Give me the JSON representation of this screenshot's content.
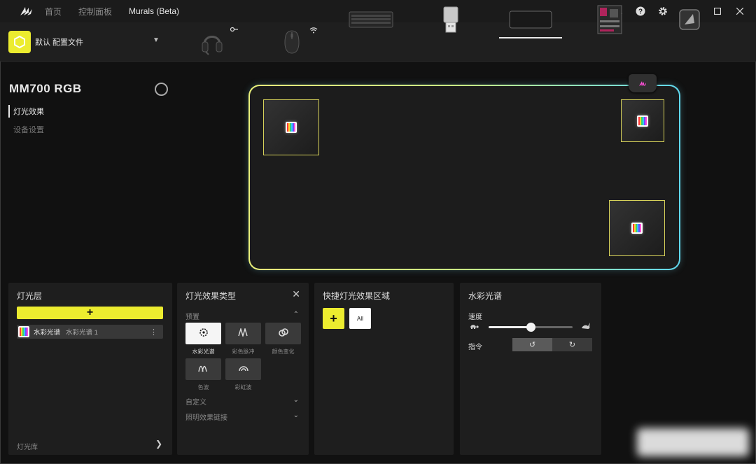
{
  "titlebar": {
    "nav": [
      "首页",
      "控制面板",
      "Murals (Beta)"
    ],
    "icons": [
      "bell-icon",
      "help-icon",
      "gear-icon",
      "minimize-icon",
      "maximize-icon",
      "close-icon"
    ]
  },
  "profile": {
    "label": "默认 配置文件"
  },
  "devices": [
    "headset-device",
    "mouse-device",
    "keyboard-device",
    "wireless-dongle-device",
    "mousepad-device",
    "motherboard-device",
    "corsair-hub-device"
  ],
  "device": {
    "title": "MM700 RGB",
    "tabs": [
      "灯光效果",
      "设备设置"
    ]
  },
  "layers_panel": {
    "title": "灯光层",
    "add_label": "+",
    "layer_name": "水彩光谱",
    "layer_sub": "水彩光谱 1",
    "more": "⋮",
    "footer": "灯光库"
  },
  "effect_panel": {
    "title": "灯光效果类型",
    "close": "✕",
    "preset_head": "预置",
    "presets": [
      {
        "label": "水彩光谱",
        "icon": "splash-icon"
      },
      {
        "label": "彩色脉冲",
        "icon": "pulse-icon"
      },
      {
        "label": "颜色变化",
        "icon": "link-icon"
      },
      {
        "label": "色波",
        "icon": "wave-icon"
      },
      {
        "label": "彩虹波",
        "icon": "rainbow-icon"
      }
    ],
    "custom_head": "自定义",
    "link_head": "照明效果链接"
  },
  "zone_panel": {
    "title": "快捷灯光效果区域",
    "add_label": "+",
    "all_label": "All"
  },
  "params_panel": {
    "title": "水彩光谱",
    "speed_label": "速度",
    "speed_value": 0.5,
    "direction_label": "指令",
    "direction_options": [
      "↺",
      "↻"
    ]
  },
  "colors": {
    "accent": "#ecec2f",
    "pad_glow_left": "#eaf07a",
    "pad_glow_right": "#5fd8ef"
  }
}
